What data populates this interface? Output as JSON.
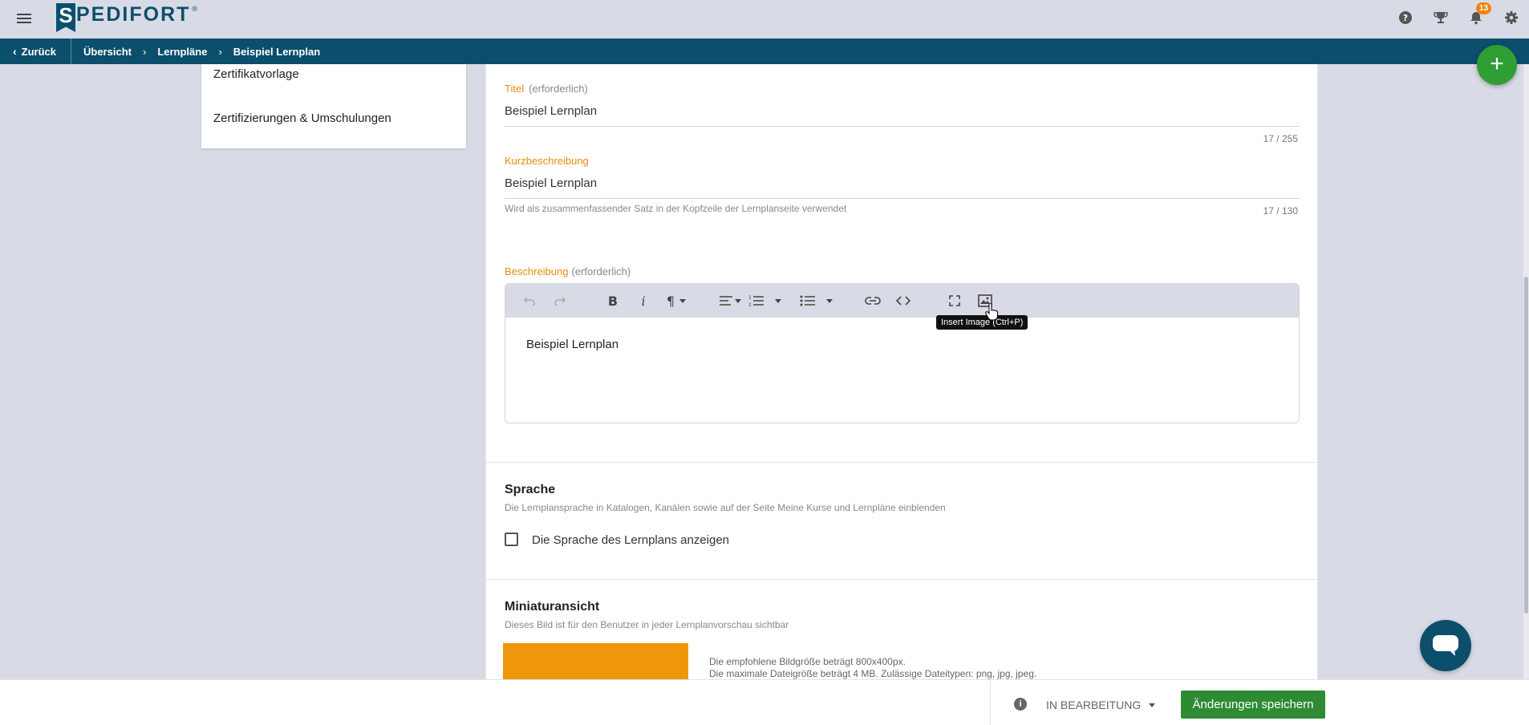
{
  "header": {
    "logo_letter": "S",
    "logo_text": "PEDIFORT",
    "logo_reg": "®",
    "notification_count": "13"
  },
  "breadcrumb": {
    "back_label": "Zurück",
    "items": [
      "Übersicht",
      "Lernpläne",
      "Beispiel Lernplan"
    ]
  },
  "fab_label": "+",
  "sidebar": {
    "items": [
      "Zertifikatvorlage",
      "Zertifizierungen & Umschulungen"
    ]
  },
  "form": {
    "title": {
      "label": "Titel",
      "required": "(erforderlich)",
      "value": "Beispiel Lernplan",
      "counter": "17 / 255"
    },
    "short_description": {
      "label": "Kurzbeschreibung",
      "value": "Beispiel Lernplan",
      "hint": "Wird als zusammenfassender Satz in der Kopfzeile der Lernplanseite verwendet",
      "counter": "17 / 130"
    },
    "description": {
      "label": "Beschreibung",
      "required": "(erforderlich)",
      "content": "Beispiel Lernplan",
      "tooltip": "Insert Image (Ctrl+P)"
    },
    "language": {
      "title": "Sprache",
      "description": "Die Lernplansprache in Katalogen, Kanälen sowie auf der Seite Meine Kurse und Lernpläne einblenden",
      "checkbox_label": "Die Sprache des Lernplans anzeigen",
      "checked": false
    },
    "thumbnail": {
      "title": "Miniaturansicht",
      "description": "Dieses Bild ist für den Benutzer in jeder Lernplanvorschau sichtbar",
      "info_size": "Die empfohlene Bildgröße beträgt 800x400px.",
      "info_limits": "Die maximale Dateigröße beträgt 4 MB. Zulässige Dateitypen: png, jpg, jpeg."
    }
  },
  "footer": {
    "status_label": "IN BEARBEITUNG",
    "save_label": "Änderungen speichern"
  },
  "colors": {
    "brand": "#0b4f6c",
    "accent_label": "#e88c0d",
    "save_button": "#2e8b34",
    "thumbnail": "#f0960a"
  }
}
